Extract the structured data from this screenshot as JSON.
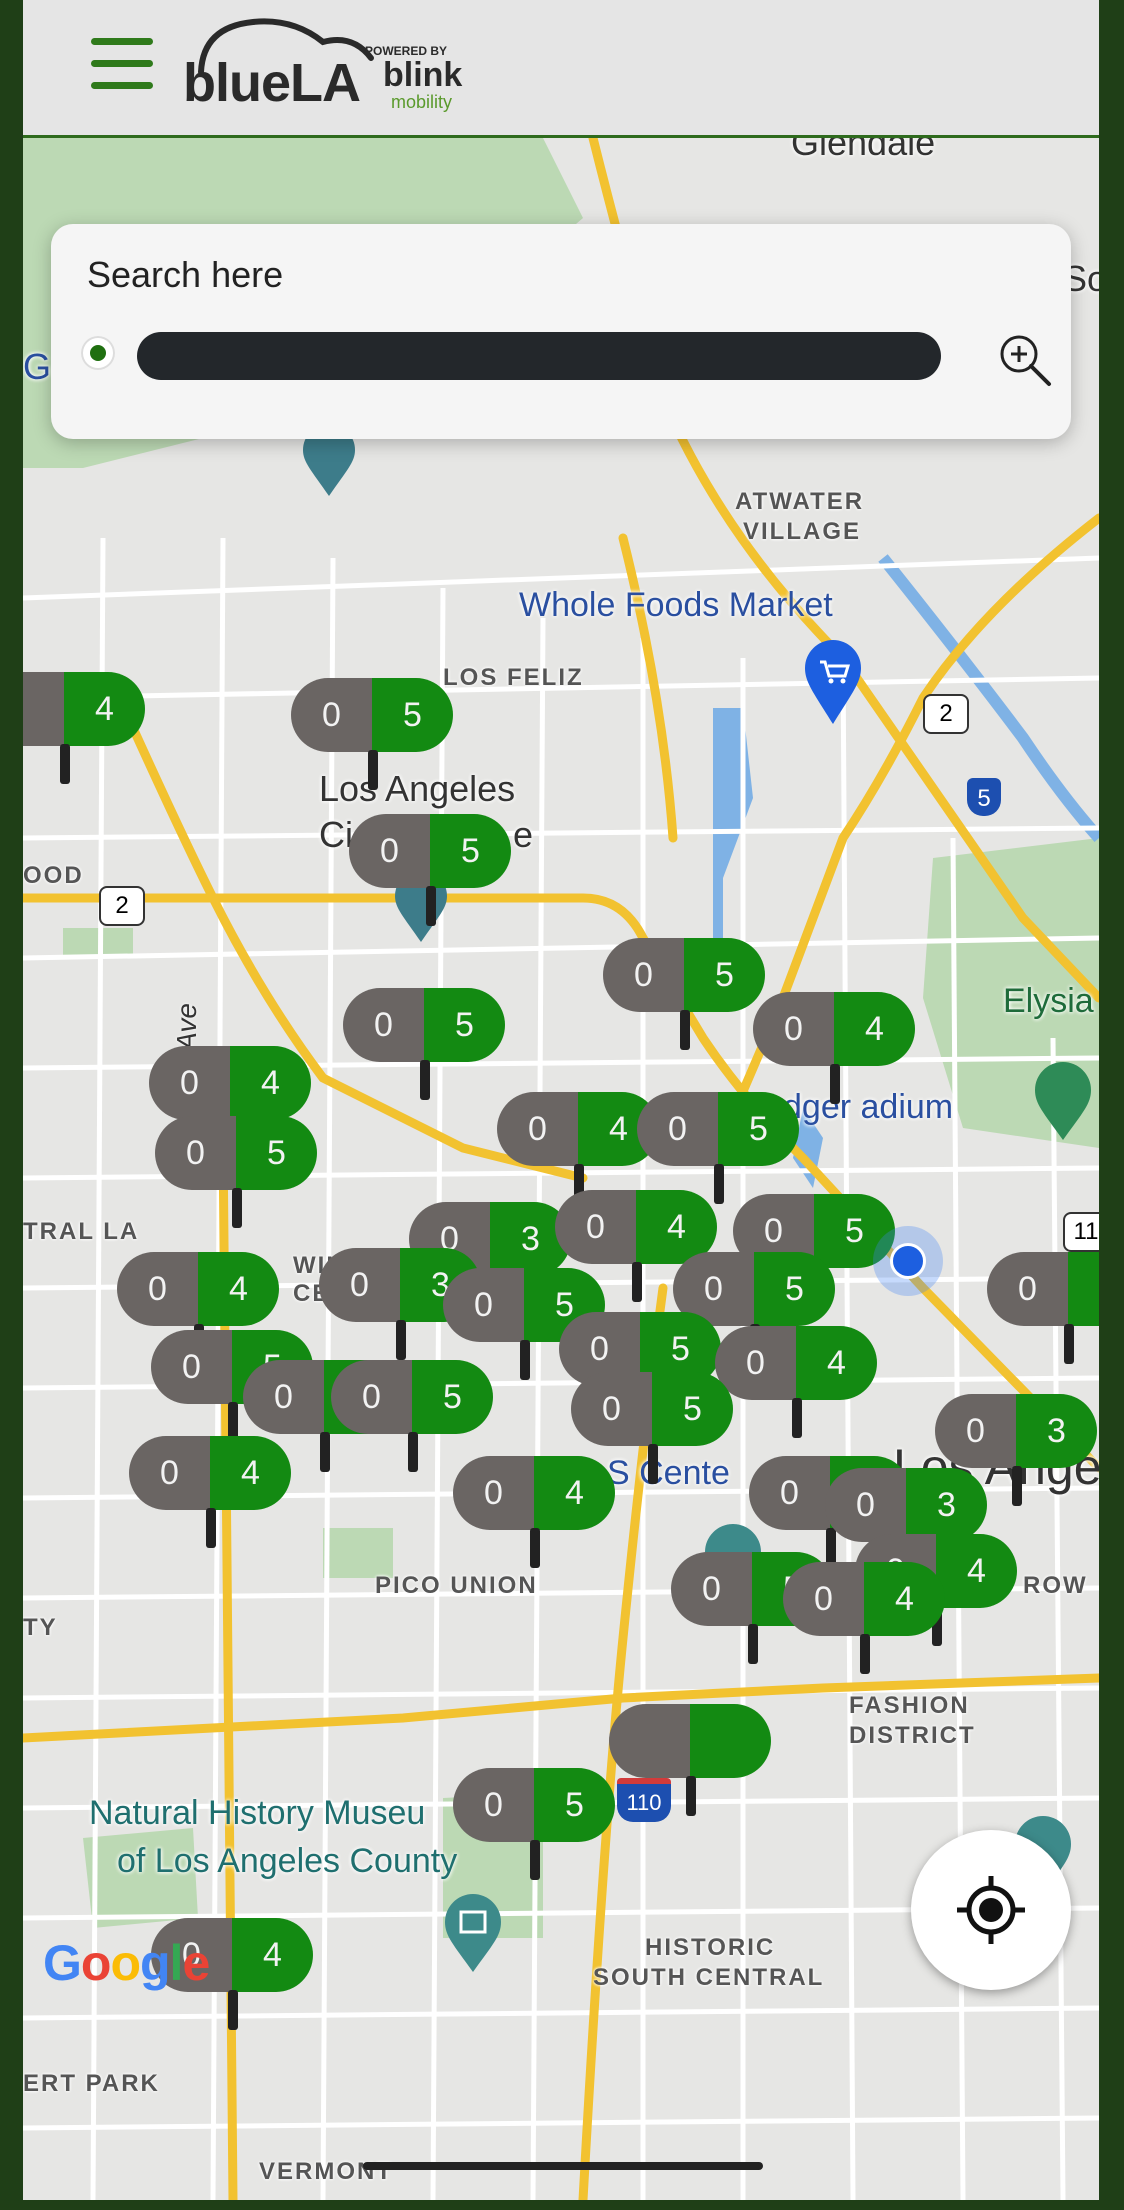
{
  "header": {
    "menu_icon": "hamburger-menu-icon",
    "logo": {
      "main": "blueLA",
      "powered_by": "POWERED BY",
      "partner": "blink",
      "partner_sub": "mobility"
    }
  },
  "search": {
    "heading": "Search here",
    "value": "",
    "origin_icon": "green-dot-icon",
    "zoom_icon": "zoom-in-icon"
  },
  "map": {
    "places": {
      "glendale": "Glendale",
      "atwater_1": "ATWATER",
      "atwater_2": "VILLAGE",
      "whole_foods": "Whole Foods Market",
      "los_feliz": "LOS FELIZ",
      "la_city_1": "Los Angeles",
      "la_city_2": "Ci",
      "la_city_2b": "e",
      "ood": "OOD",
      "elysia": "Elysia",
      "dodger_stadium": "dger  adium",
      "tral_la": "TRAL LA",
      "wils": "WILS",
      "cen": "CEN",
      "pico_union": "PICO UNION",
      "ty": "TY",
      "fashion_1": "FASHION",
      "fashion_2": "DISTRICT",
      "row": "ROW",
      "la_downtown": "Los Angel",
      "s_center": "S Cente",
      "nhm_1": "Natural History Museu",
      "nhm_2": "of Los Angeles County",
      "historic_1": "HISTORIC",
      "historic_2": "SOUTH CENTRAL",
      "ert_park": "ERT PARK",
      "vermont": "VERMONT",
      "ern_ave": "ern Ave",
      "so": "So",
      "g": "G",
      "e_small": "E",
      "highway_2a": "2",
      "highway_2b": "2",
      "highway_5": "5",
      "highway_110": "110",
      "highway_11": "11"
    },
    "google_logo": "Google"
  },
  "markers": [
    {
      "id": "m01",
      "left": "",
      "right": "4"
    },
    {
      "id": "m02",
      "left": "0",
      "right": "5"
    },
    {
      "id": "m03",
      "left": "0",
      "right": "5"
    },
    {
      "id": "m04",
      "left": "0",
      "right": "5"
    },
    {
      "id": "m05",
      "left": "0",
      "right": "5"
    },
    {
      "id": "m06",
      "left": "0",
      "right": "4"
    },
    {
      "id": "m07",
      "left": "0",
      "right": "4"
    },
    {
      "id": "m08",
      "left": "0",
      "right": "5"
    },
    {
      "id": "m09",
      "left": "0",
      "right": "4"
    },
    {
      "id": "m10",
      "left": "0",
      "right": "5"
    },
    {
      "id": "m11",
      "left": "0",
      "right": "3"
    },
    {
      "id": "m12",
      "left": "0",
      "right": "4"
    },
    {
      "id": "m13",
      "left": "0",
      "right": "5"
    },
    {
      "id": "m14",
      "left": "0",
      "right": "4"
    },
    {
      "id": "m15",
      "left": "0",
      "right": "3"
    },
    {
      "id": "m16",
      "left": "0",
      "right": "5"
    },
    {
      "id": "m17",
      "left": "0",
      "right": "5"
    },
    {
      "id": "m18",
      "left": "0",
      "right": ""
    },
    {
      "id": "m19",
      "left": "0",
      "right": "5"
    },
    {
      "id": "m20",
      "left": "0",
      "right": "4"
    },
    {
      "id": "m21",
      "left": "0",
      "right": "5"
    },
    {
      "id": "m22",
      "left": "0",
      "right": "5"
    },
    {
      "id": "m23",
      "left": "0",
      "right": "5"
    },
    {
      "id": "m24",
      "left": "0",
      "right": "5"
    },
    {
      "id": "m25",
      "left": "0",
      "right": "3"
    },
    {
      "id": "m26",
      "left": "0",
      "right": "4"
    },
    {
      "id": "m27",
      "left": "0",
      "right": "4"
    },
    {
      "id": "m28",
      "left": "0",
      "right": "5"
    },
    {
      "id": "m29",
      "left": "0",
      "right": "3"
    },
    {
      "id": "m30",
      "left": "0",
      "right": "4"
    },
    {
      "id": "m31",
      "left": "0",
      "right": "5"
    },
    {
      "id": "m32",
      "left": "0",
      "right": "4"
    },
    {
      "id": "m33",
      "left": "",
      "right": ""
    }
  ],
  "controls": {
    "locate_icon": "my-location-icon"
  },
  "colors": {
    "brand_green": "#138a12",
    "marker_gray": "#6a6563",
    "header_bg": "#e5e5e5",
    "frame_border": "#1f3f17"
  }
}
